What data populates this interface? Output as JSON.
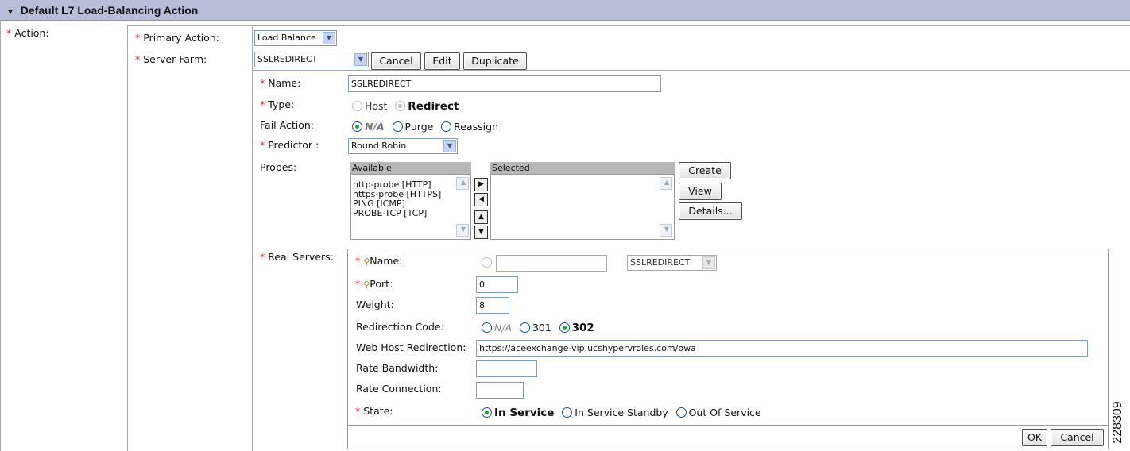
{
  "section": {
    "title": "Default L7 Load-Balancing Action",
    "collapse_icon": "triangle-down-icon"
  },
  "action": {
    "label": "Action:",
    "primary_action_label": "Primary Action:",
    "primary_action_value": "Load Balance",
    "server_farm_label": "Server Farm:",
    "server_farm_value": "SSLREDIRECT",
    "buttons": {
      "cancel": "Cancel",
      "edit": "Edit",
      "duplicate": "Duplicate"
    }
  },
  "serverfarm": {
    "name_label": "Name:",
    "name_value": "SSLREDIRECT",
    "type_label": "Type:",
    "type_options": [
      "Host",
      "Redirect"
    ],
    "type_selected": "Redirect",
    "fail_action_label": "Fail Action:",
    "fail_action_options": [
      "N/A",
      "Purge",
      "Reassign"
    ],
    "fail_action_selected": "N/A",
    "predictor_label": "Predictor :",
    "predictor_value": "Round Robin",
    "probes_label": "Probes:",
    "probes_available_header": "Available",
    "probes_selected_header": "Selected",
    "probes_available": [
      "http-probe [HTTP]",
      "https-probe [HTTPS]",
      "PING [ICMP]",
      "PROBE-TCP [TCP]"
    ],
    "probes_selected": [],
    "probe_buttons": {
      "create": "Create",
      "view": "View",
      "details": "Details..."
    }
  },
  "real_servers": {
    "label": "Real Servers:",
    "name_label": "Name:",
    "name_text_value": "",
    "name_select_value": "SSLREDIRECT",
    "port_label": "Port:",
    "port_value": "0",
    "weight_label": "Weight:",
    "weight_value": "8",
    "redirection_code_label": "Redirection Code:",
    "redirection_code_options": [
      "N/A",
      "301",
      "302"
    ],
    "redirection_code_selected": "302",
    "web_host_label": "Web Host Redirection:",
    "web_host_value": "https://aceexchange-vip.ucshypervroles.com/owa",
    "rate_bandwidth_label": "Rate Bandwidth:",
    "rate_bandwidth_value": "",
    "rate_connection_label": "Rate Connection:",
    "rate_connection_value": "",
    "state_label": "State:",
    "state_options": [
      "In Service",
      "In Service Standby",
      "Out Of Service"
    ],
    "state_selected": "In Service",
    "buttons": {
      "ok": "OK",
      "cancel": "Cancel"
    }
  },
  "figure_id": "228309",
  "required_marker": "*"
}
